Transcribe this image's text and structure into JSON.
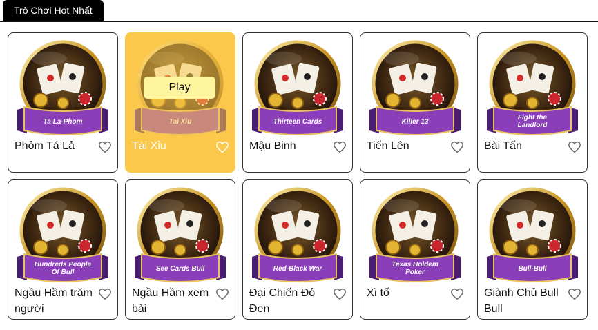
{
  "section_tab": {
    "label": "Trò Chơi Hot Nhất"
  },
  "play_label": "Play",
  "games": [
    {
      "title": "Phỏm Tá Lả",
      "art_text": "Ta La-Phom",
      "icon": "playing-cards-phom-icon",
      "accent": "#8a3fb8"
    },
    {
      "title": "Tài Xỉu",
      "art_text": "Tai Xiu",
      "icon": "dice-cup-icon",
      "accent": "#8a3fb8"
    },
    {
      "title": "Mậu Binh",
      "art_text": "Thirteen Cards",
      "icon": "revolver-icon",
      "accent": "#8a3fb8"
    },
    {
      "title": "Tiến Lên",
      "art_text": "Killer 13",
      "icon": "bomb-icon",
      "accent": "#8a3fb8"
    },
    {
      "title": "Bài Tấn",
      "art_text": "Fight the Landlord",
      "icon": "landlord-character-icon",
      "accent": "#8a3fb8"
    },
    {
      "title": "Ngầu Hầm trăm người",
      "art_text": "Hundreds People Of Bull",
      "icon": "cowboy-hat-icon",
      "accent": "#8a3fb8"
    },
    {
      "title": "Ngầu Hầm xem bài",
      "art_text": "See Cards Bull",
      "icon": "bull-character-icon",
      "accent": "#8a3fb8"
    },
    {
      "title": "Đại Chiến Đỏ Đen",
      "art_text": "Red-Black War",
      "icon": "vs-cards-icon",
      "accent": "#8a3fb8"
    },
    {
      "title": "Xì tố",
      "art_text": "Texas Holdem Poker",
      "icon": "crown-icon",
      "accent": "#8a3fb8"
    },
    {
      "title": "Giành Chủ Bull Bull",
      "art_text": "Bull-Bull",
      "icon": "golden-bull-icon",
      "accent": "#8a3fb8"
    }
  ],
  "hovered_game_index": 1
}
